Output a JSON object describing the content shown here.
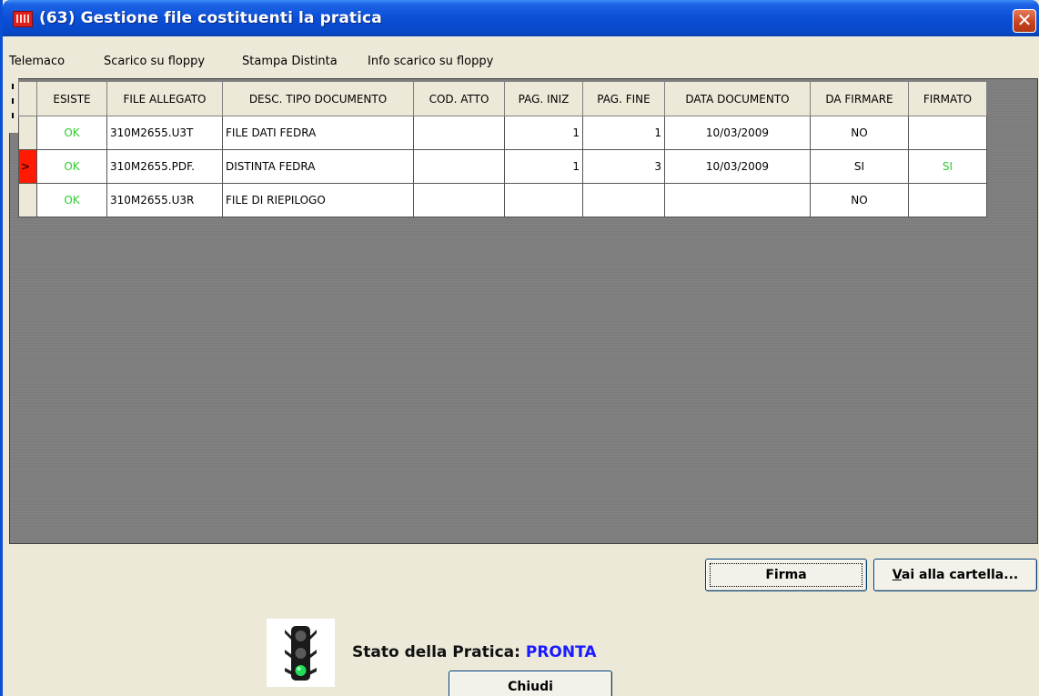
{
  "window": {
    "title": "(63) Gestione file costituenti la pratica",
    "close_label": "✕"
  },
  "menu": [
    "Telemaco",
    "Scarico su floppy",
    "Stampa Distinta",
    "Info scarico su floppy"
  ],
  "table": {
    "columns": [
      "ESISTE",
      "FILE ALLEGATO",
      "DESC. TIPO DOCUMENTO",
      "COD. ATTO",
      "PAG. INIZ",
      "PAG. FINE",
      "DATA DOCUMENTO",
      "DA FIRMARE",
      "FIRMATO"
    ],
    "rows": [
      {
        "indicator": "",
        "esiste": "OK",
        "file": "310M2655.U3T",
        "desc": "FILE DATI FEDRA",
        "cod": "",
        "pag_iniz": "1",
        "pag_fine": "1",
        "data": "10/03/2009",
        "da_firmare": "NO",
        "firmato": ""
      },
      {
        "indicator": ">",
        "esiste": "OK",
        "file": "310M2655.PDF.",
        "desc": "DISTINTA FEDRA",
        "cod": "",
        "pag_iniz": "1",
        "pag_fine": "3",
        "data": "10/03/2009",
        "da_firmare": "SI",
        "firmato": "SI"
      },
      {
        "indicator": "",
        "esiste": "OK",
        "file": "310M2655.U3R",
        "desc": "FILE DI RIEPILOGO",
        "cod": "",
        "pag_iniz": "",
        "pag_fine": "",
        "data": "",
        "da_firmare": "NO",
        "firmato": ""
      }
    ]
  },
  "buttons": {
    "firma": "Firma",
    "vai_prefix": "V",
    "vai_rest": "ai alla cartella...",
    "chiudi": "Chiudi"
  },
  "status": {
    "label": "Stato della Pratica:",
    "value": "PRONTA"
  },
  "colors": {
    "ok_green": "#2ecc2e",
    "status_blue": "#1a1aff",
    "row_indicator_red": "#ff1a00"
  },
  "icons": {
    "traffic_light": "traffic-light-icon-green"
  }
}
